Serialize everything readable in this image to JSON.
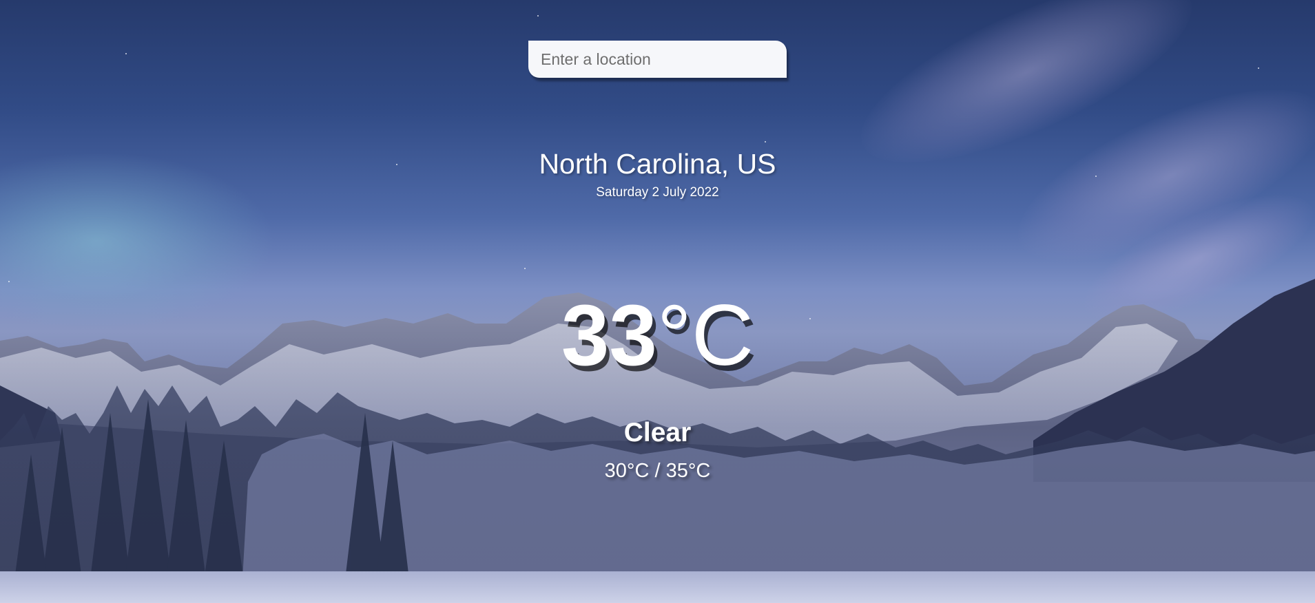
{
  "search": {
    "placeholder": "Enter a location",
    "value": ""
  },
  "location": {
    "name": "North Carolina, US",
    "date": "Saturday 2 July 2022"
  },
  "weather": {
    "temp_value": "33",
    "temp_unit": "°C",
    "condition": "Clear",
    "min_max": "30°C / 35°C"
  },
  "colors": {
    "text": "#ffffff",
    "search_background": "#ffffff",
    "sky": "#314b86",
    "snow": "#c9cfe6"
  }
}
